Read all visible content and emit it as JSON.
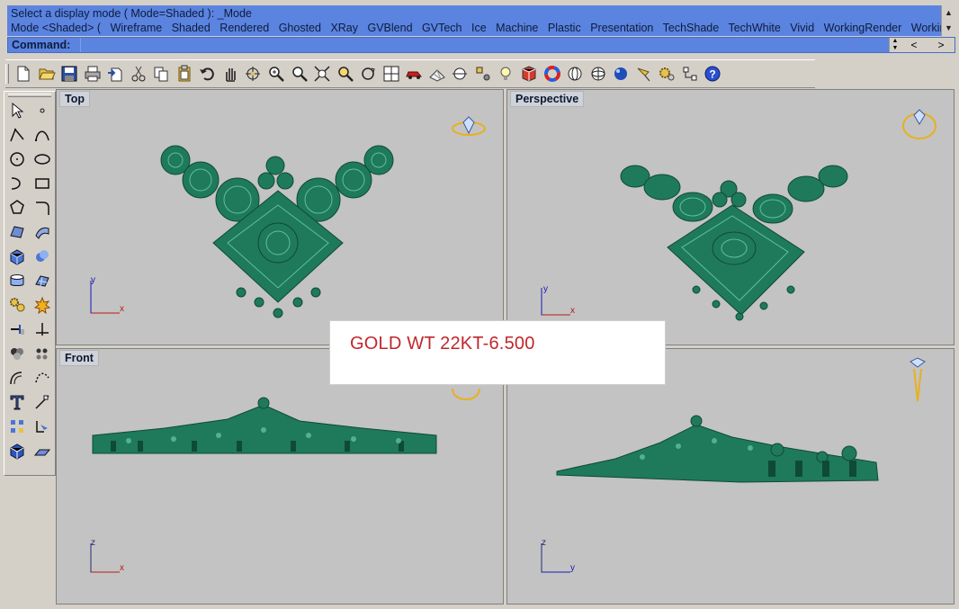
{
  "history": {
    "line1": "Select a display mode ( Mode=Shaded ): _Mode",
    "line2_prefix": "Mode <Shaded> (",
    "modes": [
      "Wireframe",
      "Shaded",
      "Rendered",
      "Ghosted",
      "XRay",
      "GVBlend",
      "GVTech",
      "Ice",
      "Machine",
      "Plastic",
      "Presentation",
      "TechShade",
      "TechWhite",
      "Vivid",
      "WorkingRender",
      "Working"
    ]
  },
  "command": {
    "label": "Command:",
    "value": "",
    "prev": "<",
    "next": ">"
  },
  "toolbar": {
    "icons": [
      "new-icon",
      "open-icon",
      "save-icon",
      "print-icon",
      "import-icon",
      "cut-icon",
      "copy-icon",
      "paste-icon",
      "undo-icon",
      "pan-icon",
      "rotate-icon",
      "zoom-icon",
      "zoom-window-icon",
      "zoom-extents-icon",
      "zoom-selected-icon",
      "rotate-view-icon",
      "four-viewports-icon",
      "car-icon",
      "grid-icon",
      "circle-snap-icon",
      "points-icon",
      "lightbulb-icon",
      "render-icon",
      "color-wheel-icon",
      "sphere-wire-icon",
      "globe-icon",
      "render-sphere-icon",
      "lamp-icon",
      "gears-icon",
      "scripts-icon",
      "help-icon"
    ]
  },
  "left_tools": {
    "icons": [
      "select-arrow-icon",
      "point-icon",
      "polyline-icon",
      "curve-icon",
      "circle-icon",
      "ellipse-icon",
      "arc-icon",
      "rectangle-icon",
      "polygon-icon",
      "fillet-curve-icon",
      "surface-icon",
      "sweep-icon",
      "box-icon",
      "boolean-icon",
      "cylinder-icon",
      "surface-patch-icon",
      "transform-icon",
      "explode-icon",
      "extend-icon",
      "trim-icon",
      "group-icon",
      "array-icon",
      "offset-curve-icon",
      "rebuild-icon",
      "text-icon",
      "dimension-icon",
      "points-grid-icon",
      "extract-icon",
      "solid-box-icon",
      "plane-icon"
    ]
  },
  "viewports": {
    "top": {
      "title": "Top",
      "axes": [
        "y",
        "x"
      ]
    },
    "perspective": {
      "title": "Perspective",
      "axes": [
        "y",
        "x"
      ]
    },
    "front": {
      "title": "Front",
      "axes": [
        "z",
        "x"
      ]
    },
    "right": {
      "title": "",
      "axes": [
        "z",
        "y"
      ]
    }
  },
  "overlay": {
    "text": "GOLD WT 22KT-6.500"
  },
  "colors": {
    "model": "#1e7a5a",
    "axis_x": "#b81a1a",
    "axis_y": "#1a1ab8",
    "axis_z": "#2a2a7a",
    "history_bg": "#5b83e0",
    "overlay_text": "#c0272d"
  }
}
